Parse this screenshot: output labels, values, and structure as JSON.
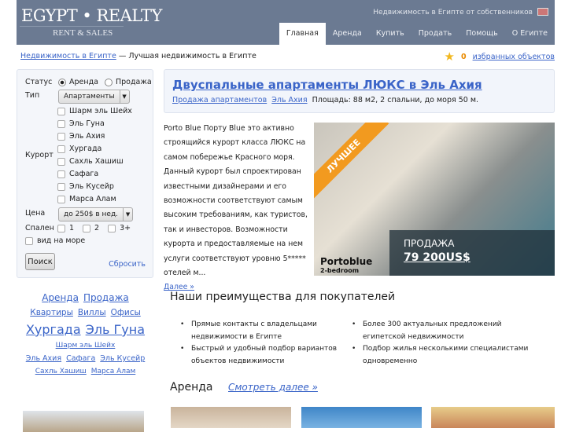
{
  "header": {
    "logo": "EGYPT • REALTY",
    "logo_sub": "RENT & SALES",
    "tagline": "Недвижимость в Египте от собственников",
    "nav": [
      "Главная",
      "Аренда",
      "Купить",
      "Продать",
      "Помощь",
      "О Египте"
    ]
  },
  "breadcrumb": {
    "link": "Недвижимость в Египте",
    "rest": " — Лучшая недвижимость в Египте"
  },
  "favorites": {
    "count": "0",
    "label": "избранных объектов"
  },
  "search": {
    "status_label": "Статус",
    "status_rent": "Аренда",
    "status_sale": "Продажа",
    "type_label": "Тип",
    "type_value": "Апартаменты",
    "resort_label": "Курорт",
    "resorts": [
      "Шарм эль Шейх",
      "Эль Гуна",
      "Эль Ахия",
      "Хургада",
      "Сахль Хашиш",
      "Сафага",
      "Эль Кусейр",
      "Марса Алам"
    ],
    "price_label": "Цена",
    "price_value": "до 250$ в нед.",
    "bedrooms_label": "Спален",
    "bedrooms": [
      "1",
      "2",
      "3+"
    ],
    "sea_view": "вид на море",
    "search_button": "Поиск",
    "reset": "Сбросить"
  },
  "featured": {
    "title": "Двуспальные апартаменты ЛЮКС в Эль Ахия",
    "link1": "Продажа апартаментов",
    "link2": "Эль Ахия",
    "meta": "Площадь: 88 м2, 2 спальни, до моря 50 м.",
    "description": "Porto Blue Порту Blue это активно строящийся курорт класса ЛЮКС на самом побережье Красного моря. Данный курорт был спроектирован известными дизайнерами и его возможности соответствуют самым высоким требованиям, как туристов, так и инвесторов. Возможности курорта и предоставляемые на нем услуги соответствуют уровню 5***** отелей м...",
    "more": "Далее »",
    "ribbon": "ЛУЧШЕЕ",
    "brand": "Portoblue",
    "brand_sub": "2-bedroom",
    "price_label": "ПРОДАЖА",
    "price": "79 200US$"
  },
  "tags": {
    "row1": [
      "Аренда",
      "Продажа"
    ],
    "row2": [
      "Квартиры",
      "Виллы",
      "Офисы"
    ],
    "row3": [
      "Хургада",
      "Эль Гуна"
    ],
    "row4": [
      "Шарм эль Шейх"
    ],
    "row5": [
      "Эль Ахия",
      "Сафага",
      "Эль Кусейр"
    ],
    "row6": [
      "Сахль Хашиш",
      "Марса Алам"
    ]
  },
  "advantages": {
    "title": "Наши преимущества для покупателей",
    "items": [
      "Прямые контакты с владельцами недвижимости в Египте",
      "Быстрый и удобный подбор вариантов объектов недвижимости",
      "Более 300 актуальных предложений египетской недвижимости",
      "Подбор жилья несколькими специалистами одновременно"
    ]
  },
  "rent": {
    "title": "Аренда",
    "more": "Смотреть далее »"
  }
}
